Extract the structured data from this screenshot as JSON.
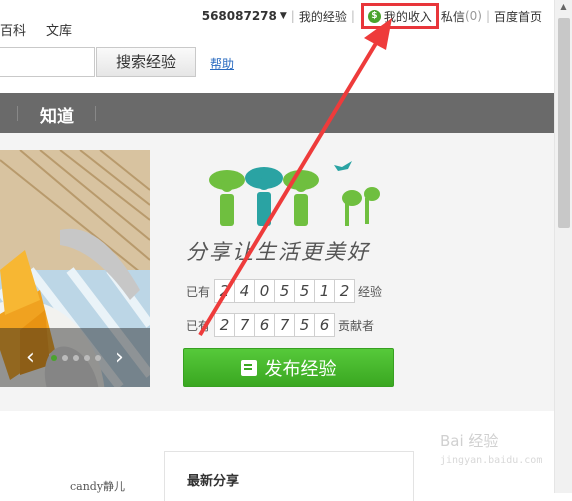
{
  "userbar": {
    "user_id": "568087278",
    "links": [
      "我的经验",
      "我的收入",
      "私信",
      "百度首页"
    ],
    "messages_count": "(0)"
  },
  "nav": {
    "left_links": [
      "百科",
      "文库"
    ],
    "section": "知道"
  },
  "search": {
    "button": "搜索经验",
    "help": "帮助"
  },
  "banner": {
    "slogan": "分享让生活更美好",
    "stat1": {
      "prefix": "已有",
      "digits": [
        "2",
        "4",
        "0",
        "5",
        "5",
        "1",
        "2"
      ],
      "suffix": "经验"
    },
    "stat2": {
      "prefix": "已有",
      "digits": [
        "2",
        "7",
        "6",
        "7",
        "5",
        "6"
      ],
      "suffix": "贡献者"
    },
    "publish_label": "发布经验",
    "carousel_dots": 5,
    "active_dot": 0
  },
  "feed": {
    "username": "candy静儿",
    "box_title": "最新分享"
  },
  "watermark": {
    "line1": "Bai 经验",
    "line2": "jingyan.baidu.com"
  },
  "colors": {
    "highlight": "#e8353a",
    "green": "#4aa32e",
    "navbar": "#6a6a6a"
  },
  "icons": [
    "coin-icon",
    "chevron-down-icon",
    "arrow-left-icon",
    "arrow-right-icon",
    "edit-icon",
    "logo-people-icon",
    "bird-icon"
  ]
}
